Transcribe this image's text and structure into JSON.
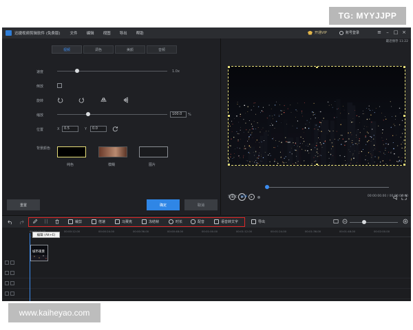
{
  "watermarks": {
    "top": "TG: MYYJJPP",
    "bottom": "www.kaiheyao.com"
  },
  "titlebar": {
    "app_title": "迅捷视频剪辑软件 (免费版)",
    "menu": [
      "文件",
      "编辑",
      "视图",
      "导出",
      "帮助"
    ],
    "vip_label": "开通VIP",
    "login_label": "账号登录",
    "window_controls": [
      "≡",
      "–",
      "□",
      "×"
    ]
  },
  "edit_panel": {
    "tabs": [
      "视频",
      "调色",
      "美颜",
      "音频"
    ],
    "active_tab": "视频",
    "speed": {
      "label": "速度",
      "value": "1.0x",
      "level": 0.18
    },
    "reverse": {
      "label": "倒放",
      "checked": false
    },
    "rotate": {
      "label": "旋转",
      "icons": [
        "rotate-left-icon",
        "rotate-right-icon",
        "flip-horizontal-icon",
        "flip-vertical-icon"
      ]
    },
    "zoom": {
      "label": "缩放",
      "value": "100.0",
      "unit": "%",
      "level": 0.28
    },
    "position": {
      "label": "位置",
      "x_label": "X",
      "x_value": "0.5",
      "y_label": "Y",
      "y_value": "0.0"
    },
    "background": {
      "label": "背景颜色",
      "options": [
        "纯色",
        "模糊",
        "图片"
      ]
    },
    "buttons": {
      "reset": "重置",
      "ok": "确定",
      "cancel": "取消"
    }
  },
  "preview": {
    "autosave": "最近保存 11:22",
    "ratio_label": "宽高比：",
    "ratio_value": "16:9",
    "time": "00:00:00.00 / 00:00:06.40",
    "progress": 0.0
  },
  "toolbar": {
    "items": [
      "裁剪",
      "倍速",
      "马赛克",
      "冻结帧",
      "时长",
      "配音",
      "语音转文字"
    ],
    "export": "导出",
    "colors": {
      "highlight_box": "#e02828",
      "accent": "#2f86e6"
    }
  },
  "timeline": {
    "ticks": [
      "00:00:00.00",
      "00:00:12.00",
      "00:00:24.00",
      "00:00:36.00",
      "00:00:48.00",
      "00:01:00.00",
      "00:01:12.00",
      "00:01:24.00",
      "00:01:36.00",
      "00:01:48.00",
      "00:02:00.00"
    ],
    "tooltip": "编辑 (Alt+E)",
    "clip_label": "城市夜景"
  }
}
